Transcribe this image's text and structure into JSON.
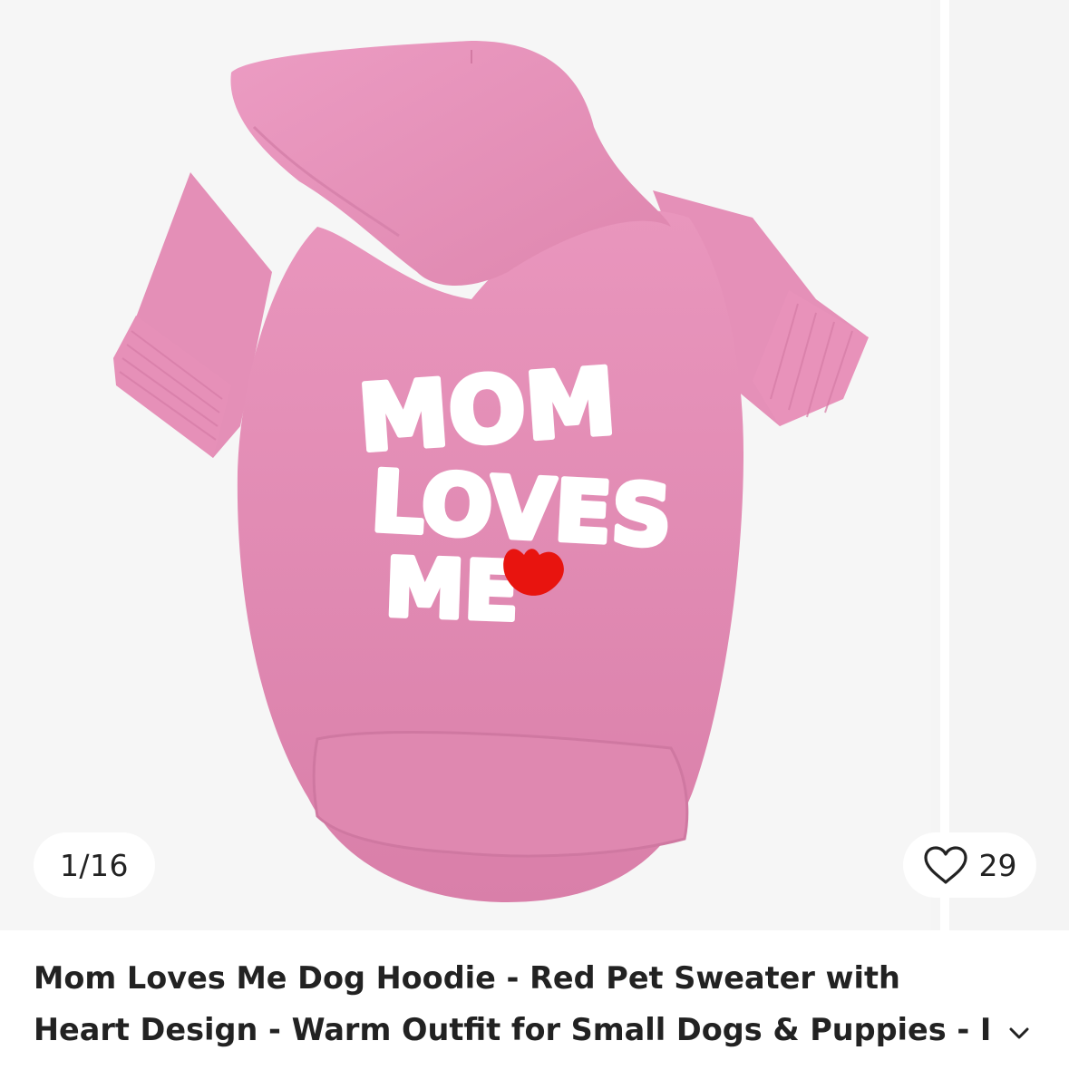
{
  "gallery": {
    "counter_text": "1/16",
    "favorite_count": "29",
    "image": {
      "subject": "pink dog hoodie",
      "print_lines": [
        "MOM",
        "LOVES",
        "ME"
      ],
      "garment_color": "#e38ab2",
      "print_color": "#ffffff",
      "heart_color": "#e8140f"
    }
  },
  "product": {
    "title": "Mom Loves Me Dog Hoodie - Red Pet Sweater with Heart Design - Warm Outfit for Small Dogs & Puppies - I Love"
  },
  "icons": {
    "favorite": "heart-outline-icon",
    "expand": "chevron-down-icon"
  }
}
